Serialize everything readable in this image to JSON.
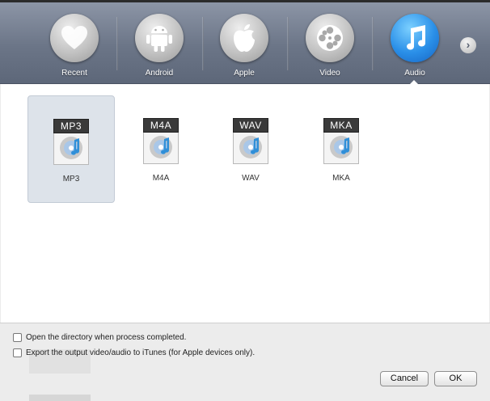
{
  "categories": [
    {
      "label": "Recent",
      "icon": "heart-icon"
    },
    {
      "label": "Android",
      "icon": "android-icon"
    },
    {
      "label": "Apple",
      "icon": "apple-icon"
    },
    {
      "label": "Video",
      "icon": "film-reel-icon"
    },
    {
      "label": "Audio",
      "icon": "music-note-icon",
      "active": true
    }
  ],
  "formats": [
    {
      "tag": "MP3",
      "name": "MP3",
      "selected": true
    },
    {
      "tag": "M4A",
      "name": "M4A"
    },
    {
      "tag": "WAV",
      "name": "WAV"
    },
    {
      "tag": "MKA",
      "name": "MKA"
    }
  ],
  "options": {
    "open_directory": "Open the directory when process completed.",
    "export_itunes": "Export the output video/audio to iTunes (for Apple devices only)."
  },
  "buttons": {
    "cancel": "Cancel",
    "ok": "OK"
  },
  "colors": {
    "accent": "#2a8fe8",
    "toolbar": "#6b7587"
  }
}
